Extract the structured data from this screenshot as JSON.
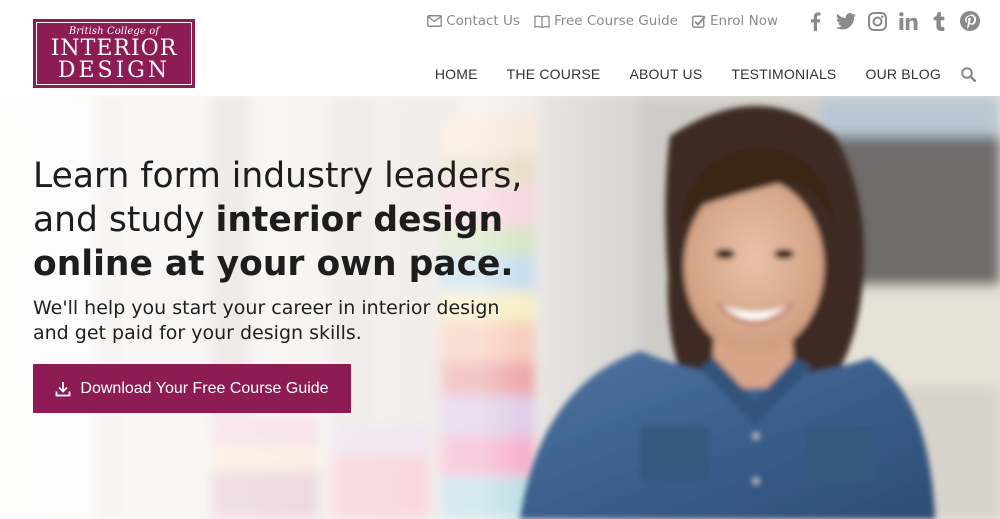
{
  "brand": {
    "line1": "British College of",
    "line2": "INTERIOR",
    "line3": "DESIGN",
    "color": "#8d1c54"
  },
  "utility": {
    "contact": {
      "label": "Contact Us",
      "icon": "envelope-icon"
    },
    "guide": {
      "label": "Free Course Guide",
      "icon": "book-icon"
    },
    "enrol": {
      "label": "Enrol Now",
      "icon": "checkbox-icon"
    }
  },
  "social": [
    "facebook-icon",
    "twitter-icon",
    "instagram-icon",
    "linkedin-icon",
    "tumblr-icon",
    "pinterest-icon"
  ],
  "nav": {
    "home": "HOME",
    "course": "THE COURSE",
    "about": "ABOUT US",
    "testimonials": "TESTIMONIALS",
    "blog": "OUR BLOG",
    "search_icon": "search-icon"
  },
  "hero": {
    "headline_plain": "Learn form industry leaders, and study ",
    "headline_bold": "interior design online at your own pace.",
    "subtext": "We'll help you start your career in interior design and get paid for your design skills.",
    "cta_label": "Download Your Free Course Guide",
    "cta_icon": "download-icon"
  }
}
